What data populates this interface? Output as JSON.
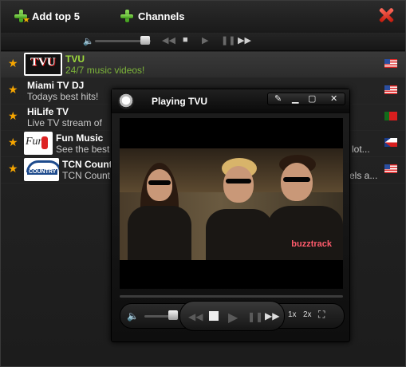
{
  "toolbar": {
    "add_top_label": "Add top 5",
    "channels_label": "Channels"
  },
  "channels": [
    {
      "name": "TVU",
      "desc": "24/7 music videos!",
      "flag": "US",
      "selected": true
    },
    {
      "name": "Miami TV DJ",
      "desc": "Todays best hits!",
      "flag": "US"
    },
    {
      "name": "HiLife TV",
      "desc": "Live TV stream of",
      "flag": "PT"
    },
    {
      "name": "Fun Music",
      "desc": "See the best",
      "desc_tail": "a lot...",
      "flag": "CZ"
    },
    {
      "name": "TCN Count",
      "desc": "TCN Count",
      "desc_tail": "els a...",
      "flag": "US"
    }
  ],
  "thumbs": {
    "tvu": "TVU",
    "fun": "Fun",
    "tcn": "COUNTRY"
  },
  "player": {
    "title": "Playing TVU",
    "watermark": "buzztrack",
    "zoom_1x": "1x",
    "zoom_2x": "2x"
  },
  "colors": {
    "selected_name": "#9fdc3c",
    "star": "#f7a600",
    "close": "#d9251a"
  }
}
